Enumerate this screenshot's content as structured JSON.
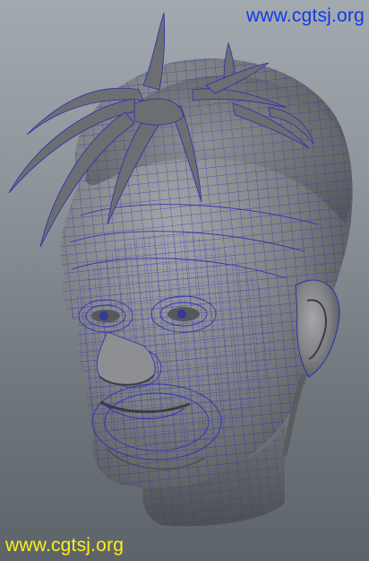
{
  "watermarks": {
    "top": "www.cgtsj.org",
    "bottom": "www.cgtsj.org"
  },
  "colors": {
    "background_top": "#a2aab0",
    "background_bottom": "#5d6469",
    "mesh_surface": "#8b8d91",
    "wireframe": "#2b2db0",
    "watermark_top": "#1238e8",
    "watermark_bottom": "#ffef1a"
  },
  "subject": {
    "icon": "head-model-icon"
  }
}
